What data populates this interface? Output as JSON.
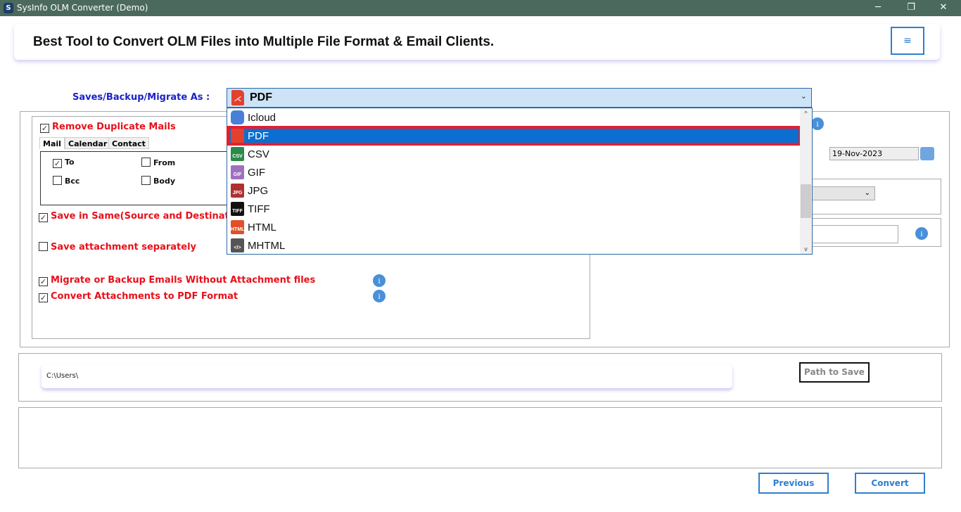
{
  "window": {
    "title": "SysInfo OLM Converter (Demo)",
    "logo": "S",
    "minimize": "─",
    "restore": "❐",
    "close": "✕"
  },
  "banner": {
    "title": "Best Tool to Convert OLM Files into Multiple File Format & Email Clients.",
    "menu_icon": "≡"
  },
  "saveas": {
    "label": "Saves/Backup/Migrate As :",
    "selected": "PDF",
    "options": [
      {
        "label": "Icloud",
        "icon": "cloud-icon"
      },
      {
        "label": "PDF",
        "icon": "pdf-icon"
      },
      {
        "label": "CSV",
        "icon": "csv-icon"
      },
      {
        "label": "GIF",
        "icon": "gif-icon"
      },
      {
        "label": "JPG",
        "icon": "jpg-icon"
      },
      {
        "label": "TIFF",
        "icon": "tiff-icon"
      },
      {
        "label": "HTML",
        "icon": "html-icon"
      },
      {
        "label": "MHTML",
        "icon": "mhtml-icon"
      }
    ],
    "icon_text": {
      "csv": "CSV",
      "gif": "GIF",
      "jpg": "JPG",
      "tiff": "TIFF",
      "html": "HTML",
      "mhtml": "</>"
    }
  },
  "options": {
    "remove_duplicates": "Remove Duplicate Mails",
    "tabs": [
      "Mail",
      "Calendar",
      "Contact"
    ],
    "fields": [
      {
        "label": "To",
        "checked": true
      },
      {
        "label": "From",
        "checked": false
      },
      {
        "label": "Bcc",
        "checked": false
      },
      {
        "label": "Body",
        "checked": false
      }
    ],
    "save_same": "Save in Same(Source and Destination Fol",
    "save_attach": "Save attachment separately",
    "migrate_without": "Migrate or Backup Emails Without Attachment files",
    "convert_attach": "Convert Attachments to PDF Format"
  },
  "date": "19-Nov-2023",
  "path": {
    "value": "C:\\Users\\",
    "button": "Path to Save"
  },
  "buttons": {
    "previous": "Previous",
    "convert": "Convert"
  }
}
